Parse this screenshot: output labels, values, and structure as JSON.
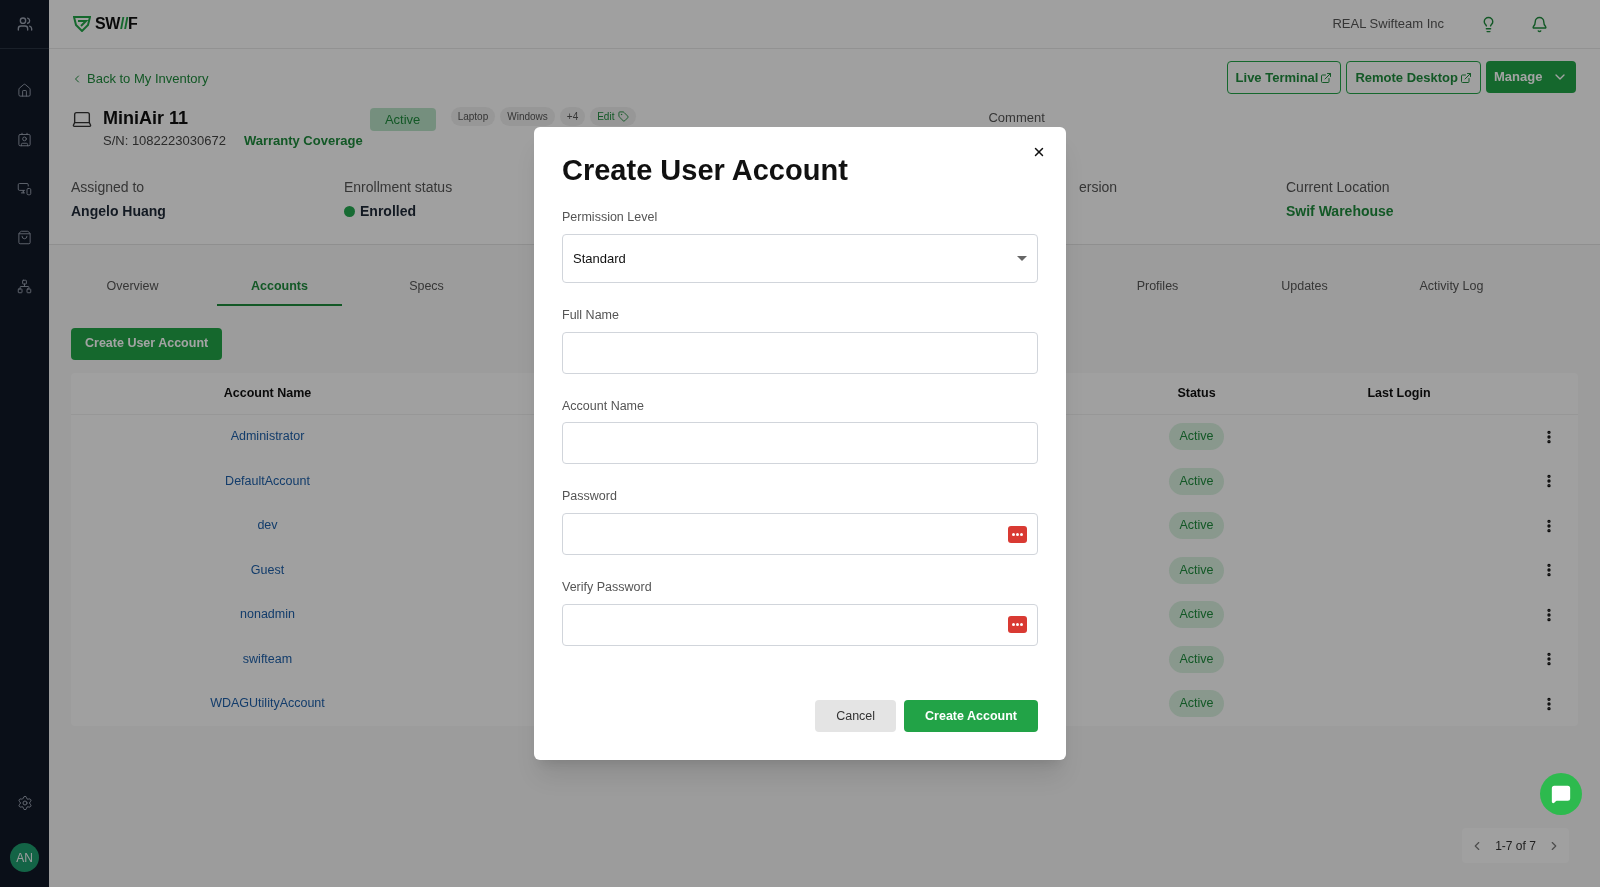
{
  "sidebar": {
    "avatar": "AN"
  },
  "header": {
    "brand": [
      {
        "text": "SW",
        "accent": false
      },
      {
        "text": "//",
        "accent": true
      },
      {
        "text": "F",
        "accent": false
      }
    ],
    "organization": "REAL Swifteam Inc"
  },
  "back_link": "Back to My Inventory",
  "actions": [
    {
      "label": "Live Terminal",
      "kind": "external"
    },
    {
      "label": "Remote Desktop",
      "kind": "external"
    },
    {
      "label": "Manage",
      "kind": "menu"
    }
  ],
  "device": {
    "name": "MiniAir 11",
    "serial": "S/N: 1082223030672",
    "warranty": "Warranty Coverage",
    "status": "Active",
    "tags": [
      "Laptop",
      "Windows",
      "+4"
    ],
    "edit_tags": "Edit",
    "comment_label": "Comment"
  },
  "info": [
    {
      "label": "Assigned to",
      "value": "Angelo Huang",
      "kind": "text"
    },
    {
      "label": "Enrollment status",
      "value": "Enrolled",
      "kind": "status",
      "color": "#176b33"
    },
    {
      "label": "ersion",
      "kind": "empty"
    },
    {
      "label": "Current Location",
      "value": "Swif Warehouse",
      "kind": "link"
    }
  ],
  "tabs": [
    {
      "label": "Overview",
      "selected": false
    },
    {
      "label": "Accounts",
      "selected": true
    },
    {
      "label": "Specs",
      "selected": false
    },
    {
      "kind": "gap"
    },
    {
      "label": "Profiles",
      "selected": false
    },
    {
      "label": "Updates",
      "selected": false
    },
    {
      "label": "Activity Log",
      "selected": false
    }
  ],
  "create_button": "Create User Account",
  "table": {
    "columns": [
      "Account Name",
      "Status",
      "Last Login"
    ],
    "rows": [
      {
        "account_name": "Administrator",
        "status": "Active"
      },
      {
        "account_name": "DefaultAccount",
        "status": "Active"
      },
      {
        "account_name": "dev",
        "status": "Active"
      },
      {
        "account_name": "Guest",
        "status": "Active"
      },
      {
        "account_name": "nonadmin",
        "status": "Active"
      },
      {
        "account_name": "swifteam",
        "status": "Active"
      },
      {
        "account_name": "WDAGUtilityAccount",
        "status": "Active"
      }
    ]
  },
  "pagination": "1-7 of 7",
  "dialog": {
    "title": "Create User Account",
    "fields": [
      {
        "label": "Permission Level",
        "kind": "select",
        "value": "Standard"
      },
      {
        "label": "Full Name",
        "kind": "text"
      },
      {
        "label": "Account Name",
        "kind": "text"
      },
      {
        "label": "Password",
        "kind": "password"
      },
      {
        "label": "Verify Password",
        "kind": "password"
      }
    ],
    "buttons": [
      {
        "label": "Cancel",
        "kind": "secondary"
      },
      {
        "label": "Create Account",
        "kind": "primary"
      }
    ]
  }
}
